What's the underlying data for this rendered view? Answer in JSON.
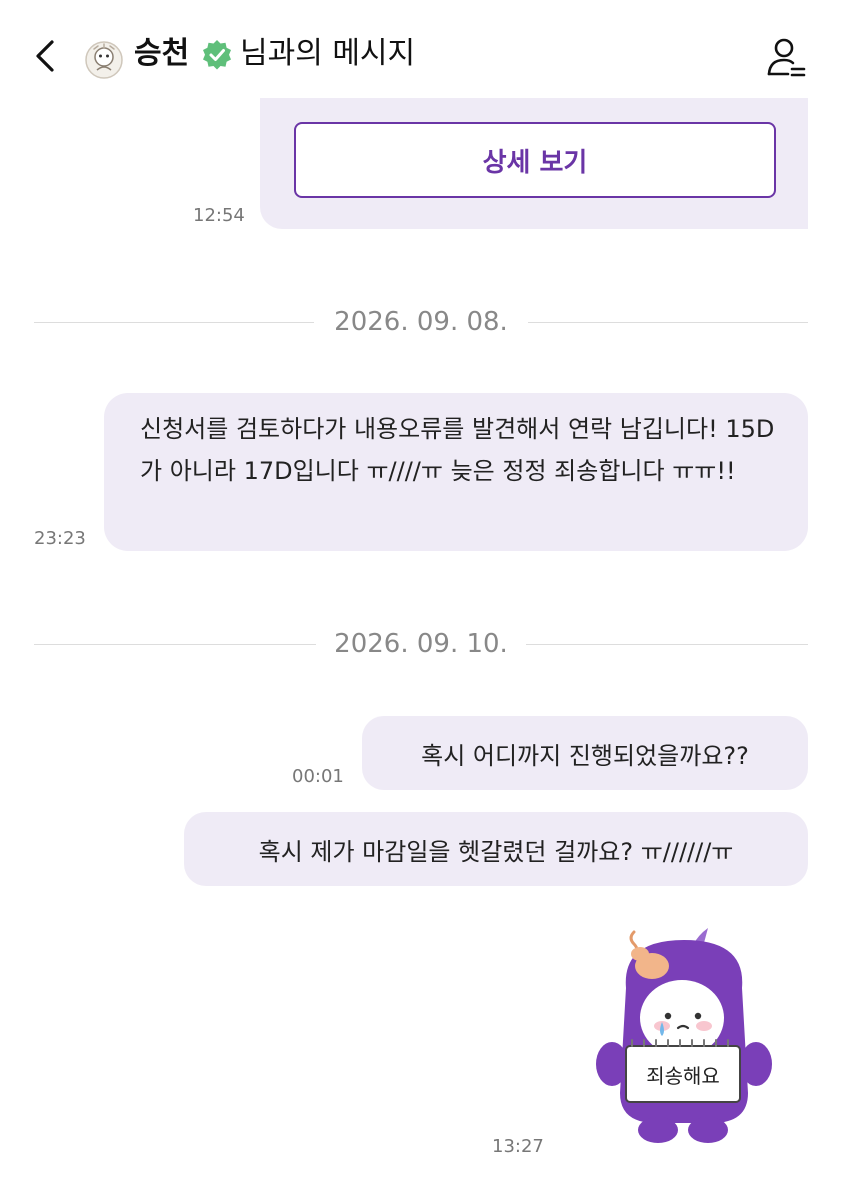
{
  "header": {
    "name": "승천",
    "title_suffix": "님과의 메시지",
    "icons": {
      "back": "chevron-left-icon",
      "verified": "verified-check-icon",
      "profile": "profile-menu-icon"
    },
    "verified_color": "#5fbf7a"
  },
  "messages": {
    "card": {
      "button_label": "상세 보기",
      "time": "12:54"
    },
    "date1": "2026. 09. 08.",
    "msg1": {
      "text": "신청서를 검토하다가 내용오류를 발견해서 연락 남깁니다! 15D가 아니라 17D입니다 ㅠ////ㅠ 늦은 정정 죄송합니다 ㅠㅠ!!",
      "time": "23:23"
    },
    "date2": "2026. 09. 10.",
    "msg2": {
      "text": "혹시 어디까지 진행되었을까요??",
      "time": "00:01"
    },
    "msg3": {
      "text": "혹시 제가 마감일을 헷갈렸던 걸까요? ㅠ//////ㅠ"
    },
    "sticker": {
      "sign_text": "죄송해요",
      "time": "13:27"
    }
  },
  "colors": {
    "accent": "#6a35a6",
    "bubble": "#efebf6",
    "sticker_body": "#7a3fb8"
  }
}
